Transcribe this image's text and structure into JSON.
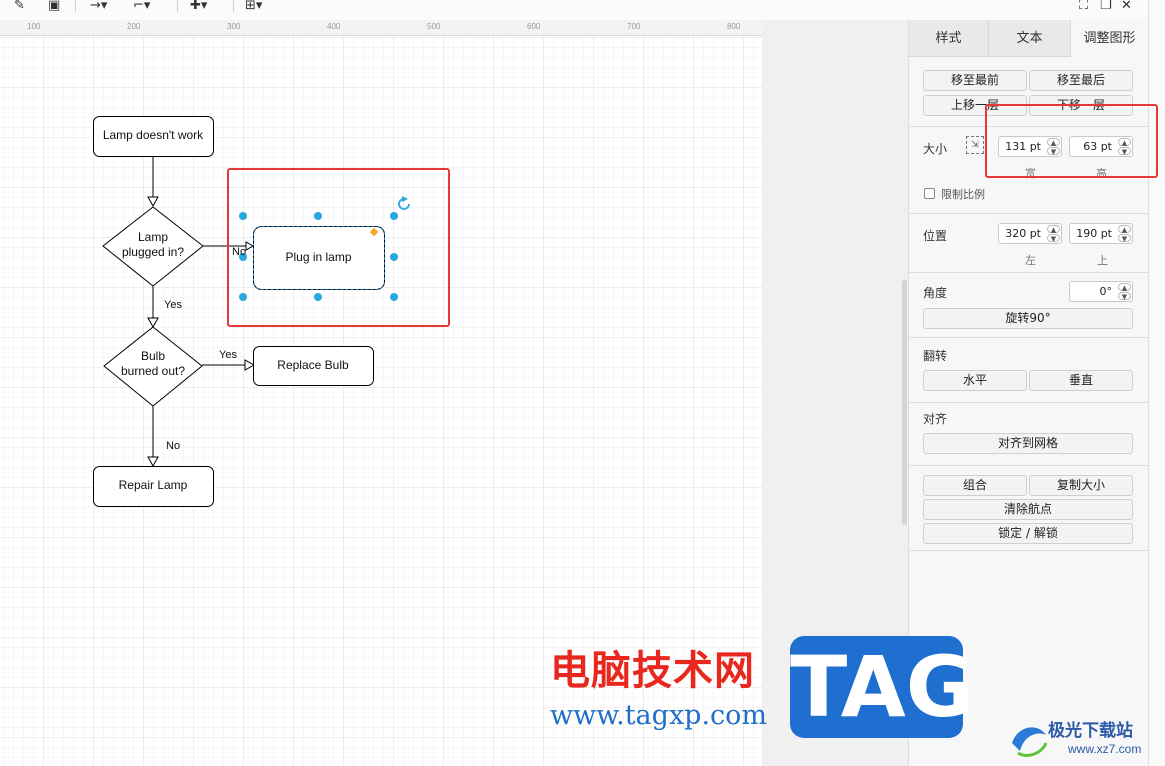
{
  "toolbar": {
    "icons": [
      "pencil-icon",
      "shadow-icon",
      "connection-icon",
      "waypoint-icon",
      "insert-icon",
      "table-icon"
    ],
    "window_icons": [
      "fullscreen-icon",
      "restore-icon",
      "close-icon"
    ]
  },
  "ruler": {
    "labels": [
      "100",
      "200",
      "300",
      "400",
      "500",
      "600",
      "700",
      "800"
    ]
  },
  "diagram": {
    "nodes": {
      "lamp_doesnt_work": "Lamp doesn't work",
      "lamp_plugged_in": [
        "Lamp",
        "plugged in?"
      ],
      "plug_in_lamp": "Plug in lamp",
      "bulb_burned_out": [
        "Bulb",
        "burned out?"
      ],
      "replace_bulb": "Replace Bulb",
      "repair_lamp": "Repair Lamp"
    },
    "edges": {
      "no1": "No",
      "yes1": "Yes",
      "yes2": "Yes",
      "no2": "No"
    },
    "colors": {
      "stroke": "#000000",
      "handle": "#29a8e0",
      "selection": "#1a6fb5",
      "highlight": "#e53935"
    }
  },
  "panel": {
    "tabs": [
      "样式",
      "文本",
      "调整图形"
    ],
    "active_tab": "调整图形",
    "order": {
      "to_front": "移至最前",
      "to_back": "移至最后",
      "forward": "上移一层",
      "backward": "下移一层"
    },
    "size": {
      "label": "大小",
      "width": "131 pt",
      "height": "63 pt",
      "width_label": "宽",
      "height_label": "高",
      "constrain": "限制比例"
    },
    "position": {
      "label": "位置",
      "left": "320 pt",
      "top": "190 pt",
      "left_label": "左",
      "top_label": "上"
    },
    "angle": {
      "label": "角度",
      "value": "0°",
      "rotate": "旋转90°"
    },
    "flip": {
      "label": "翻转",
      "horizontal": "水平",
      "vertical": "垂直"
    },
    "align": {
      "label": "对齐",
      "to_grid": "对齐到网格"
    },
    "actions": {
      "group": "组合",
      "copy_size": "复制大小",
      "clear_waypoints": "清除航点",
      "lock": "锁定 / 解锁"
    }
  },
  "watermark": {
    "site_name": "电脑技术网",
    "url": "www.tagxp.com",
    "tag": "TAG",
    "logo_name": "极光下载站",
    "logo_url": "www.xz7.com"
  }
}
